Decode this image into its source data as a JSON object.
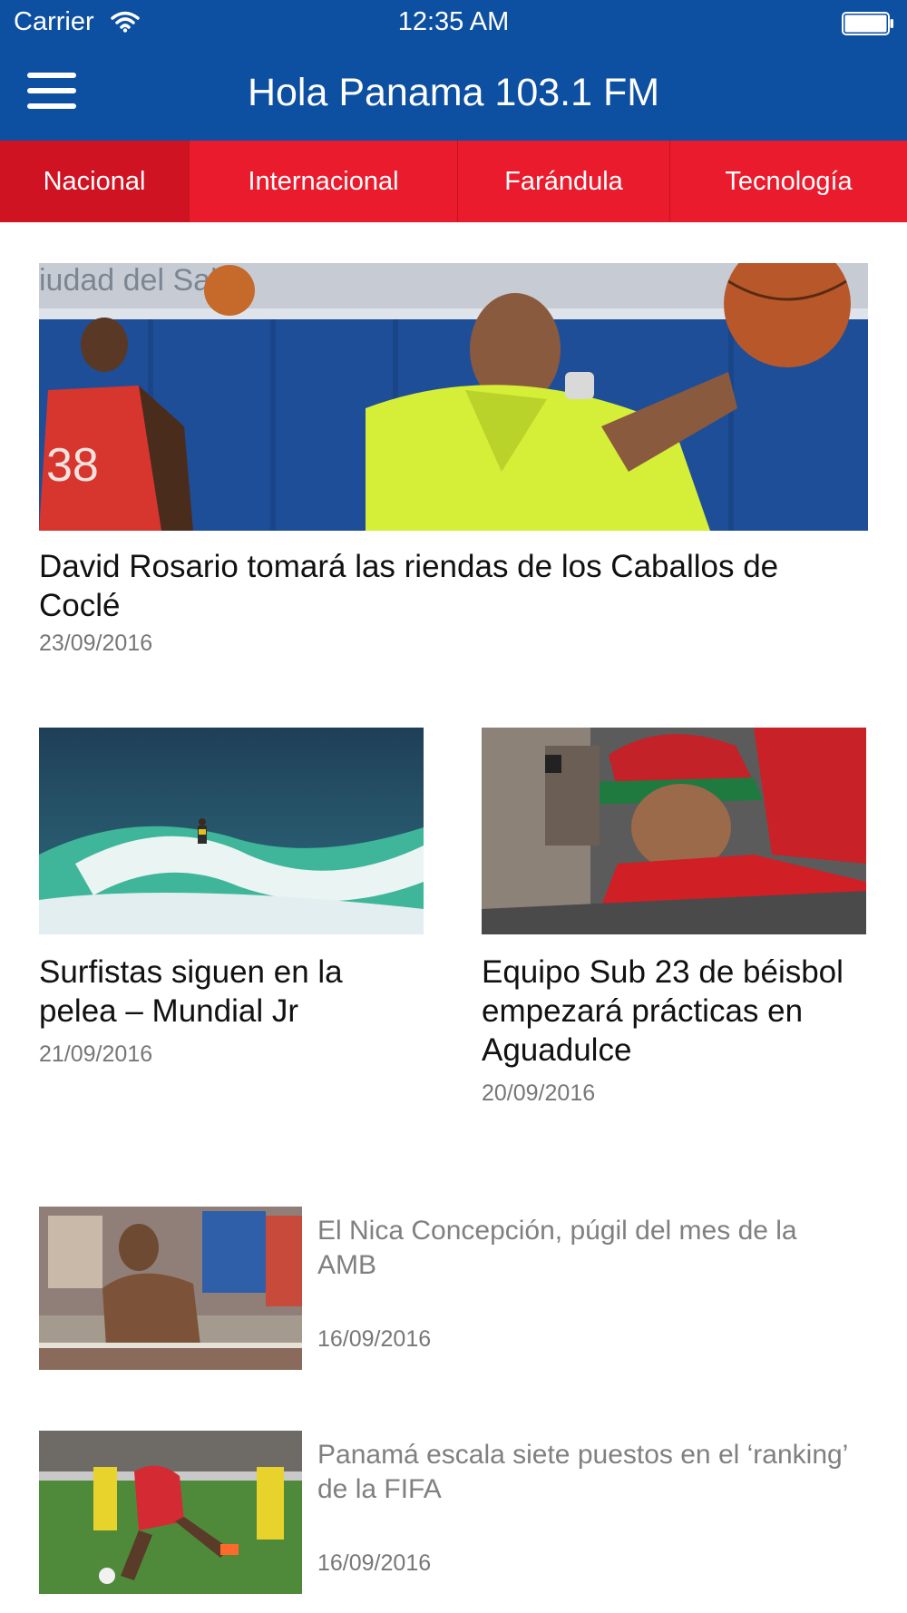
{
  "status_bar": {
    "carrier": "Carrier",
    "time": "12:35 AM"
  },
  "header": {
    "title": "Hola Panama 103.1 FM"
  },
  "tabs": [
    {
      "label": "Nacional",
      "active": true
    },
    {
      "label": "Internacional",
      "active": false
    },
    {
      "label": "Farándula",
      "active": false
    },
    {
      "label": "Tecnología",
      "active": false
    }
  ],
  "featured": {
    "title": "David Rosario tomará las riendas de los Caballos de Coclé",
    "date": "23/09/2016",
    "image_text": "iudad del Sabe"
  },
  "cards": [
    {
      "title": "Surfistas siguen en la pelea – Mundial Jr",
      "date": "21/09/2016"
    },
    {
      "title": "Equipo Sub 23 de béisbol empezará prácticas en Aguadulce",
      "date": "20/09/2016"
    }
  ],
  "list": [
    {
      "title": "El Nica Concepción, púgil del mes de la AMB",
      "date": "16/09/2016"
    },
    {
      "title": "Panamá escala siete puestos en el ‘ranking’ de la FIFA",
      "date": "16/09/2016"
    }
  ],
  "colors": {
    "header": "#0d4fa1",
    "tabs": "#ea1b2c",
    "tab_active": "#cf1322"
  }
}
